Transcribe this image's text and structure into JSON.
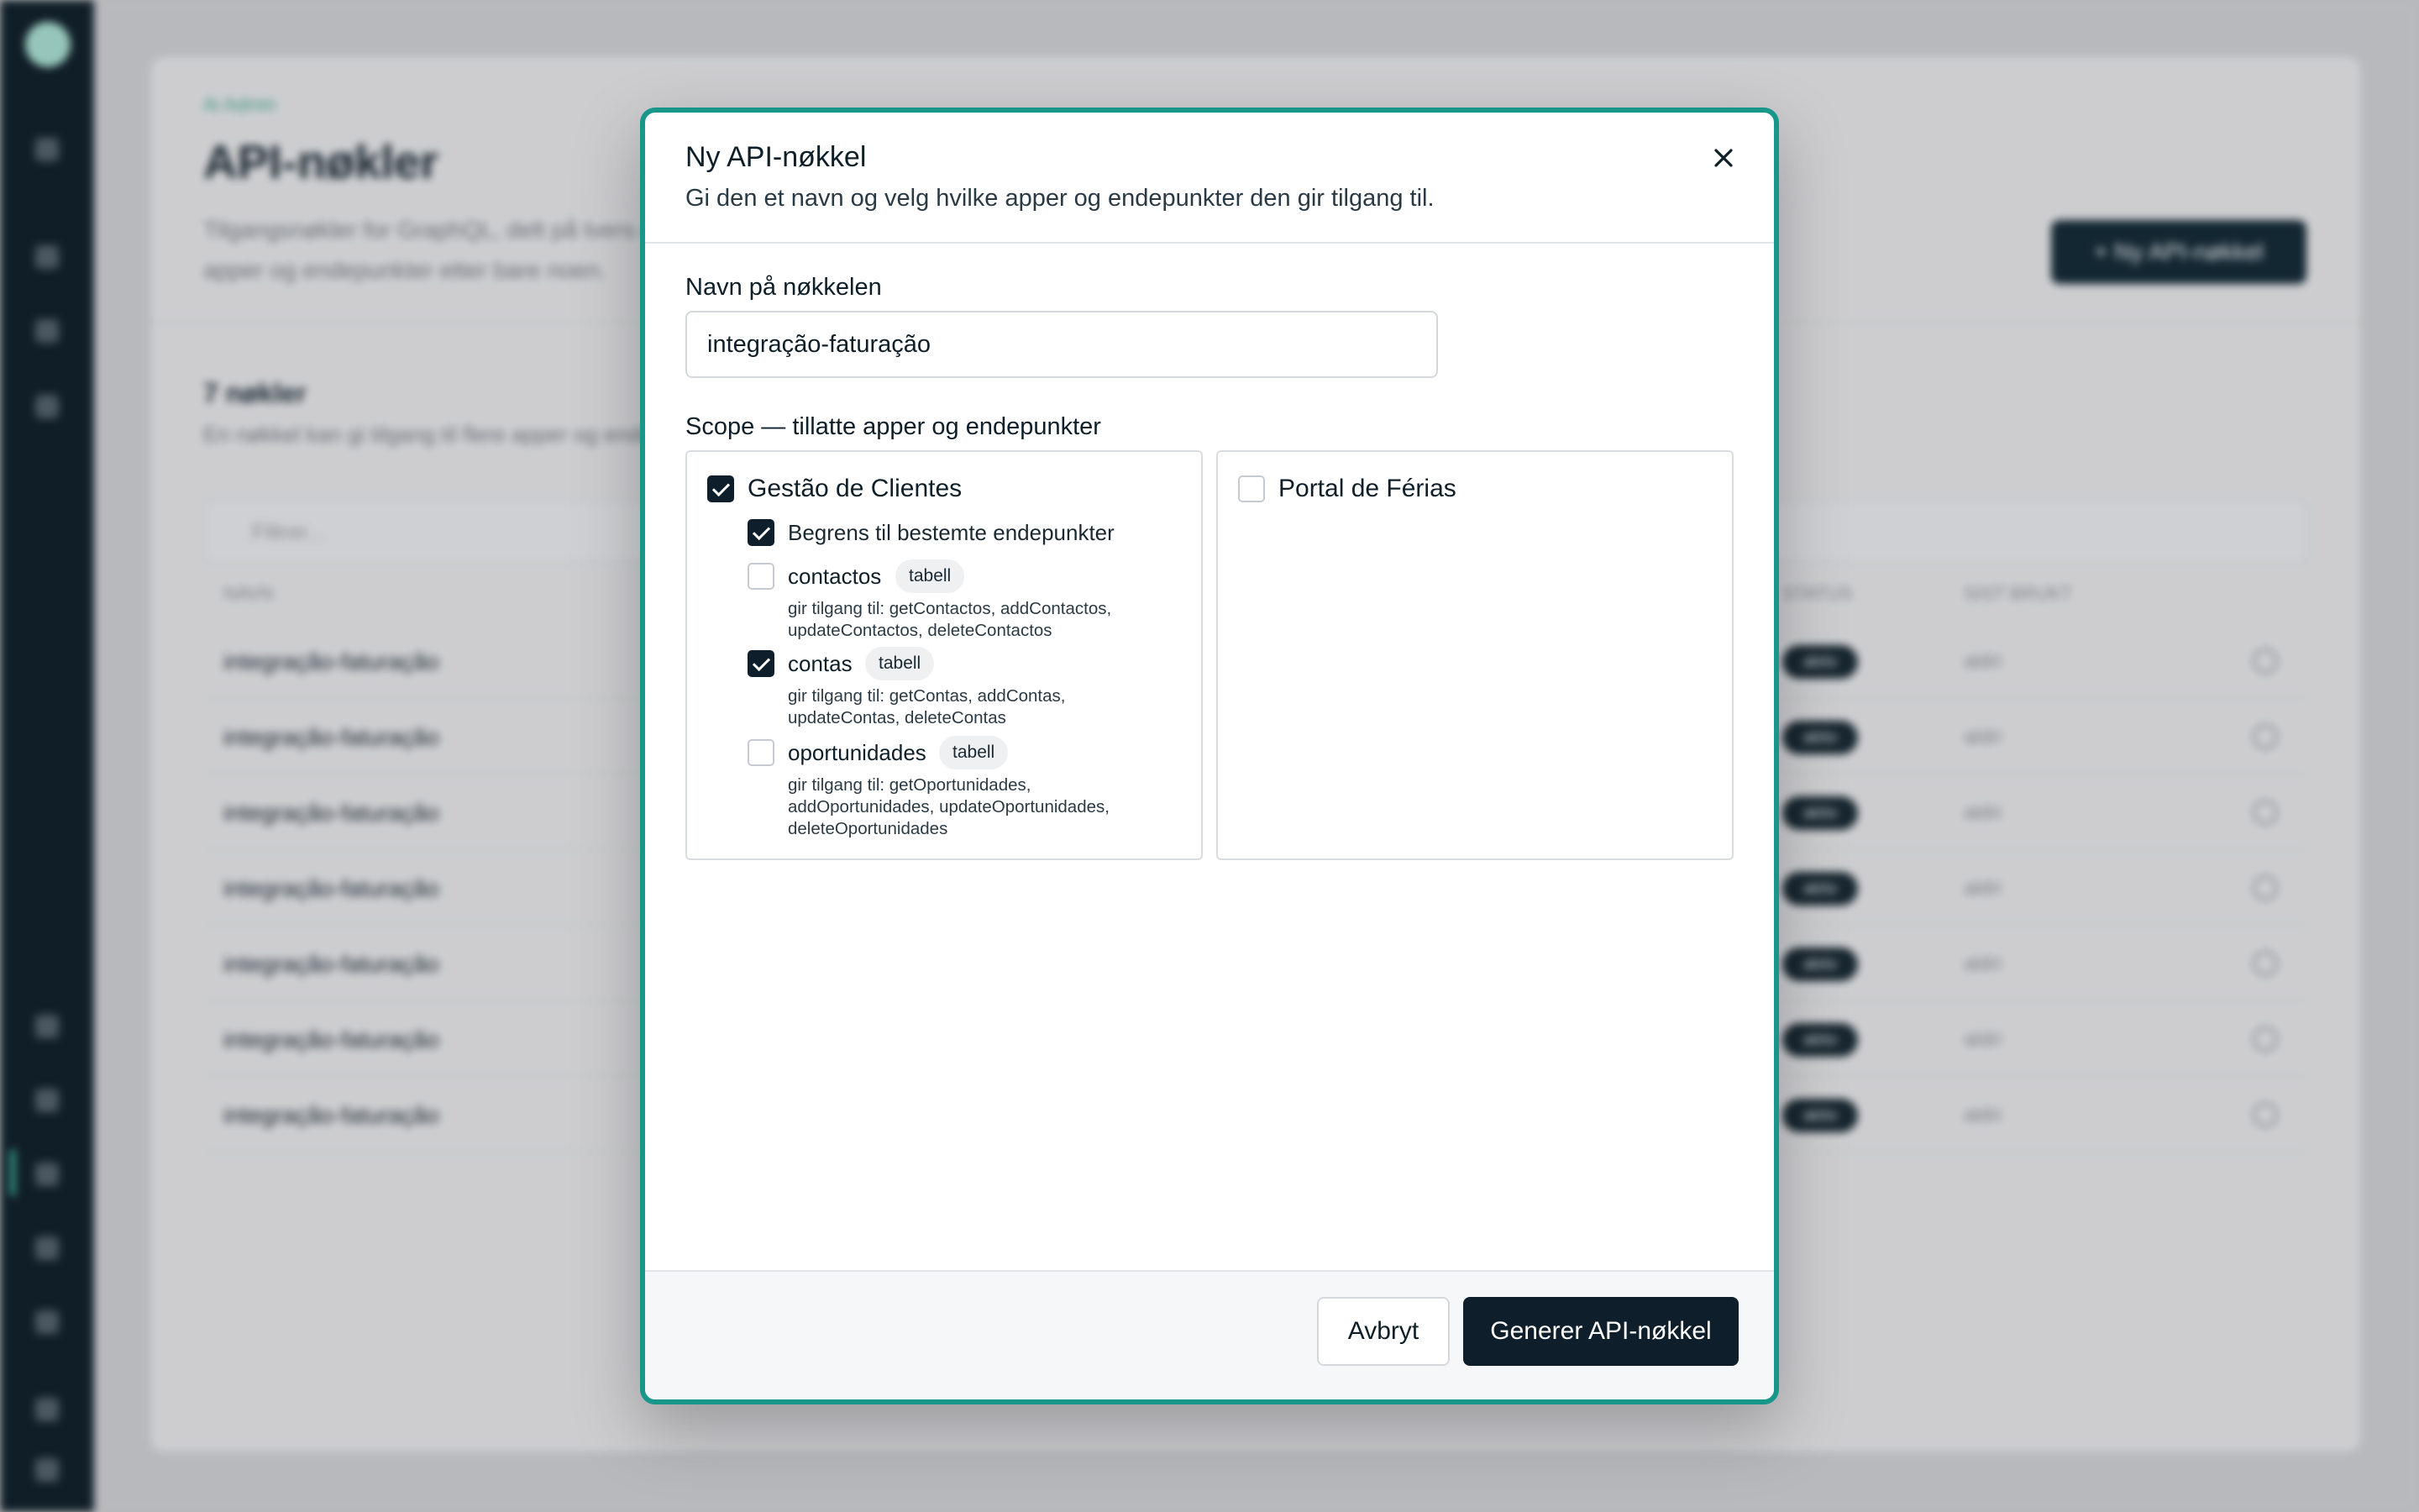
{
  "background": {
    "breadcrumb": "Ai Admin",
    "page_title": "API-nøkler",
    "page_description": "Tilgangsnøkler for GraphQL, delt på tvers av apper og endepunkter etter bare noen.",
    "new_key_button": "+ Ny API-nøkkel",
    "count_title": "7 nøkler",
    "count_subtitle": "En nøkkel kan gi tilgang til flere apper og endepunkter.",
    "filter_placeholder": "Filtrer...",
    "columns": [
      "NAVN",
      "STATUS",
      "SIST BRUKT"
    ],
    "rows": [
      {
        "name": "integração-faturação",
        "status": "aktiv",
        "last_used": "aldri"
      },
      {
        "name": "integração-faturação",
        "status": "aktiv",
        "last_used": "aldri"
      },
      {
        "name": "integração-faturação",
        "status": "aktiv",
        "last_used": "aldri"
      },
      {
        "name": "integração-faturação",
        "status": "aktiv",
        "last_used": "aldri"
      },
      {
        "name": "integração-faturação",
        "status": "aktiv",
        "last_used": "aldri"
      },
      {
        "name": "integração-faturação",
        "status": "aktiv",
        "last_used": "aldri"
      },
      {
        "name": "integração-faturação",
        "status": "aktiv",
        "last_used": "aldri"
      }
    ]
  },
  "modal": {
    "title": "Ny API-nøkkel",
    "subtitle": "Gi den et navn og velg hvilke apper og endepunkter den gir tilgang til.",
    "name_label": "Navn på nøkkelen",
    "name_value": "integração-faturação",
    "scope_label": "Scope — tillatte apper og endepunkter",
    "apps": [
      {
        "name": "Gestão de Clientes",
        "checked": true,
        "restrict_label": "Begrens til bestemte endepunkter",
        "restrict_checked": true,
        "endpoints": [
          {
            "name": "contactos",
            "tag": "tabell",
            "checked": false,
            "desc": "gir tilgang til: getContactos, addContactos, updateContactos, deleteContactos"
          },
          {
            "name": "contas",
            "tag": "tabell",
            "checked": true,
            "desc": "gir tilgang til: getContas, addContas, updateContas, deleteContas"
          },
          {
            "name": "oportunidades",
            "tag": "tabell",
            "checked": false,
            "desc": "gir tilgang til: getOportunidades, addOportunidades, updateOportunidades, deleteOportunidades"
          }
        ]
      },
      {
        "name": "Portal de Férias",
        "checked": false
      }
    ],
    "cancel_label": "Avbryt",
    "generate_label": "Generer API-nøkkel"
  },
  "colors": {
    "accent": "#17968a",
    "primary_dark": "#0e1f2b",
    "sidebar": "#0d1c26"
  },
  "icons": [
    "close-icon",
    "check-icon",
    "filter-icon",
    "plus-icon"
  ]
}
